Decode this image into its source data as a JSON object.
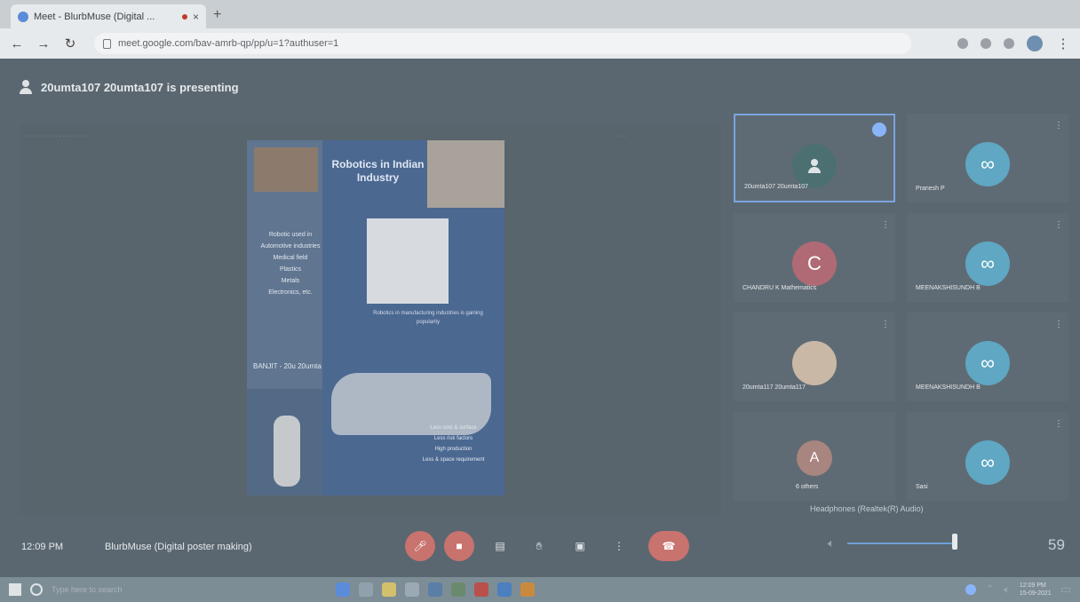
{
  "browser": {
    "tab_title": "Meet - BlurbMuse (Digital ...",
    "tab_close": "×",
    "new_tab": "+",
    "url": "meet.google.com/bav-amrb-qp/pp/u=1?authuser=1"
  },
  "meet": {
    "presenting_text": "20umta107 20umta107 is presenting",
    "poster": {
      "title": "Robotics in Indian Industry",
      "list": [
        "Robotic used in",
        "Automotive industries",
        "Medical field",
        "Plastics",
        "Metals",
        "Electronics, etc."
      ],
      "caption": "Robotics in manufacturing industries is gaining popularity",
      "scribble": "BANJIT - 20u 20umta",
      "bottom_lines": [
        "Less cost & surface",
        "Less risk factors",
        "High production",
        "Less & space requirement"
      ]
    },
    "participants": [
      {
        "name": "20umta107 20umta107",
        "initial": "",
        "color": "#4c6f72",
        "active": true
      },
      {
        "name": "Pranesh P",
        "initial": "",
        "color": "#5fa7c3",
        "active": false
      },
      {
        "name": "CHANDRU K Mathematics",
        "initial": "C",
        "color": "#b06a75",
        "active": false
      },
      {
        "name": "MEENAKSHISUNDH B",
        "initial": "",
        "color": "#5fa7c3",
        "active": false
      },
      {
        "name": "20umta117 20umta117",
        "initial": "",
        "color": "#c9b8a6",
        "active": false
      },
      {
        "name": "MEENAKSHISUNDH B",
        "initial": "",
        "color": "#5fa7c3",
        "active": false
      },
      {
        "name": "6 others",
        "initial": "A",
        "color": "#a9857f",
        "active": false
      },
      {
        "name": "Sasi",
        "initial": "",
        "color": "#5fa7c3",
        "active": false
      }
    ],
    "call_caption": "Headphones (Realtek(R) Audio)"
  },
  "controls": {
    "time": "12:09 PM",
    "meeting_name": "BlurbMuse (Digital poster making)",
    "volume_value": "59"
  },
  "taskbar": {
    "search_placeholder": "Type here to search",
    "clock_time": "12:09 PM",
    "clock_date": "15-09-2021"
  }
}
